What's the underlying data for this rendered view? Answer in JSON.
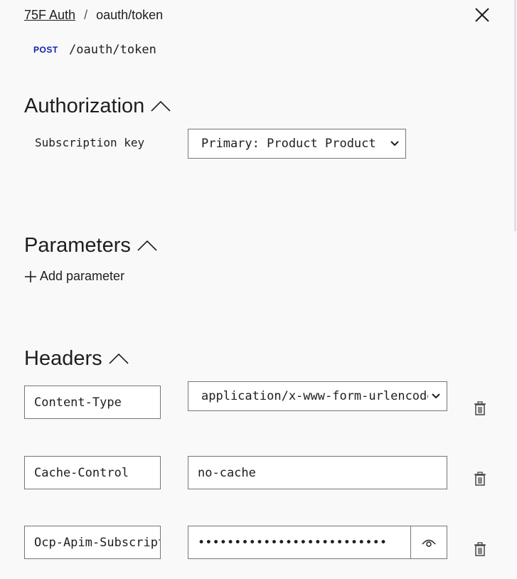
{
  "breadcrumb": {
    "parent": "75F Auth",
    "separator": "/",
    "current": "oauth/token"
  },
  "request": {
    "method": "POST",
    "path": "/oauth/token"
  },
  "authorization": {
    "title": "Authorization",
    "subscription_key_label": "Subscription key",
    "subscription_key_value": "Primary: Product Product"
  },
  "parameters": {
    "title": "Parameters",
    "add_label": "Add parameter"
  },
  "headers": {
    "title": "Headers",
    "rows": [
      {
        "name": "Content-Type",
        "value": "application/x-www-form-urlencoded"
      },
      {
        "name": "Cache-Control",
        "value": "no-cache"
      },
      {
        "name": "Ocp-Apim-Subscription-Key",
        "value": "••••••••••••••••••••••••••"
      }
    ]
  },
  "icons": {
    "close": "close-icon",
    "chevron": "chevron-up-icon",
    "plus": "plus-icon",
    "trash": "trash-icon",
    "eye": "eye-icon",
    "caret": "chevron-down-icon"
  },
  "colors": {
    "method": "#0b1fb3",
    "background": "#f9f9f9",
    "border": "#767676"
  }
}
